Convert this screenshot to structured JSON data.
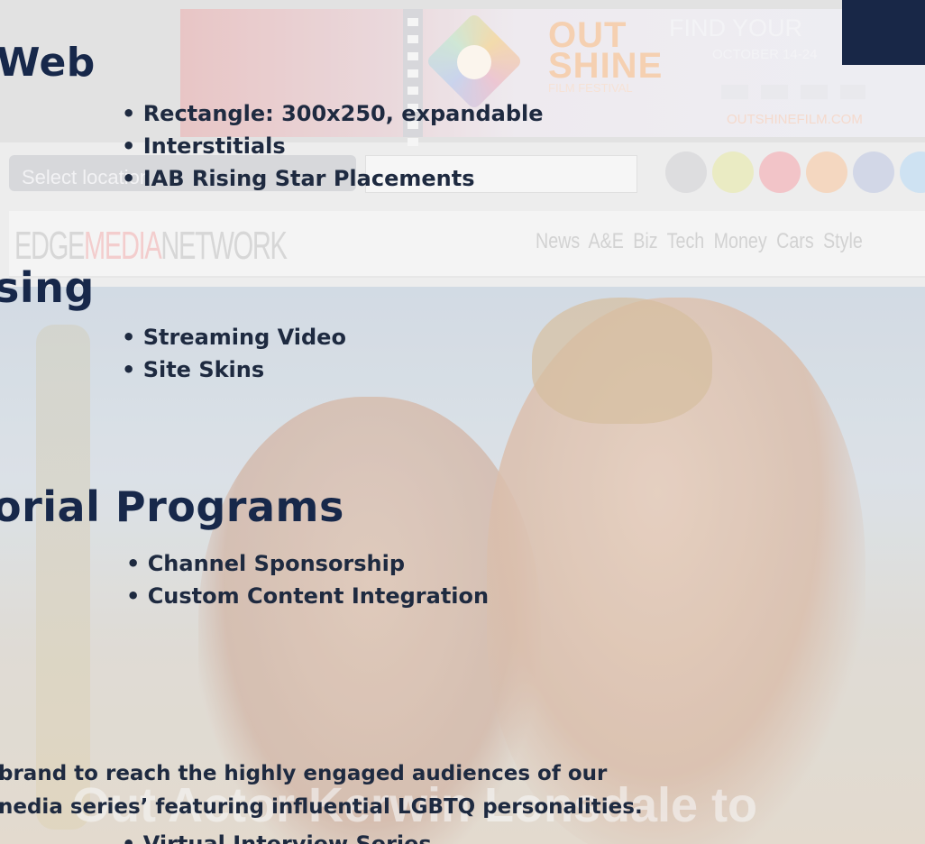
{
  "background_site": {
    "select_placeholder": "Select location",
    "logo": {
      "part1": "EDGE",
      "part2": "MEDIA",
      "part3": "NETWORK"
    },
    "nav_items": [
      "News",
      "A&E",
      "Biz",
      "Tech",
      "Money",
      "Cars",
      "Style"
    ],
    "banner": {
      "brand_line1": "OUT",
      "brand_line2": "SHINE",
      "brand_line3": "FILM FESTIVAL",
      "find_text": "FIND YOUR",
      "date": "OCTOBER 14-24",
      "url": "OUTSHINEFILM.COM"
    },
    "social_icons": [
      "apple-icon",
      "android-icon",
      "email-icon",
      "rss-icon",
      "facebook-icon",
      "twitter-icon"
    ],
    "headline_partial": "Out Actor Kerwin Lonsdale to"
  },
  "slide": {
    "sections": [
      {
        "heading": "Web",
        "bullets": [
          "• Rectangle: 300x250, expandable",
          "• Interstitials",
          "• IAB Rising Star Placements"
        ]
      },
      {
        "heading": "sing",
        "bullets": [
          "• Streaming Video",
          "• Site Skins"
        ]
      },
      {
        "heading": "orial Programs",
        "bullets": [
          "• Channel Sponsorship",
          "• Custom Content Integration"
        ]
      }
    ],
    "body_lines": [
      "brand to reach the highly engaged audiences of our",
      "nedia series’ featuring influential LGBTQ personalities."
    ],
    "last_bullet": "• Virtual Interview Series"
  },
  "colors": {
    "heading": "#17284a",
    "text": "#1e2a40",
    "dark_block": "#182747"
  }
}
